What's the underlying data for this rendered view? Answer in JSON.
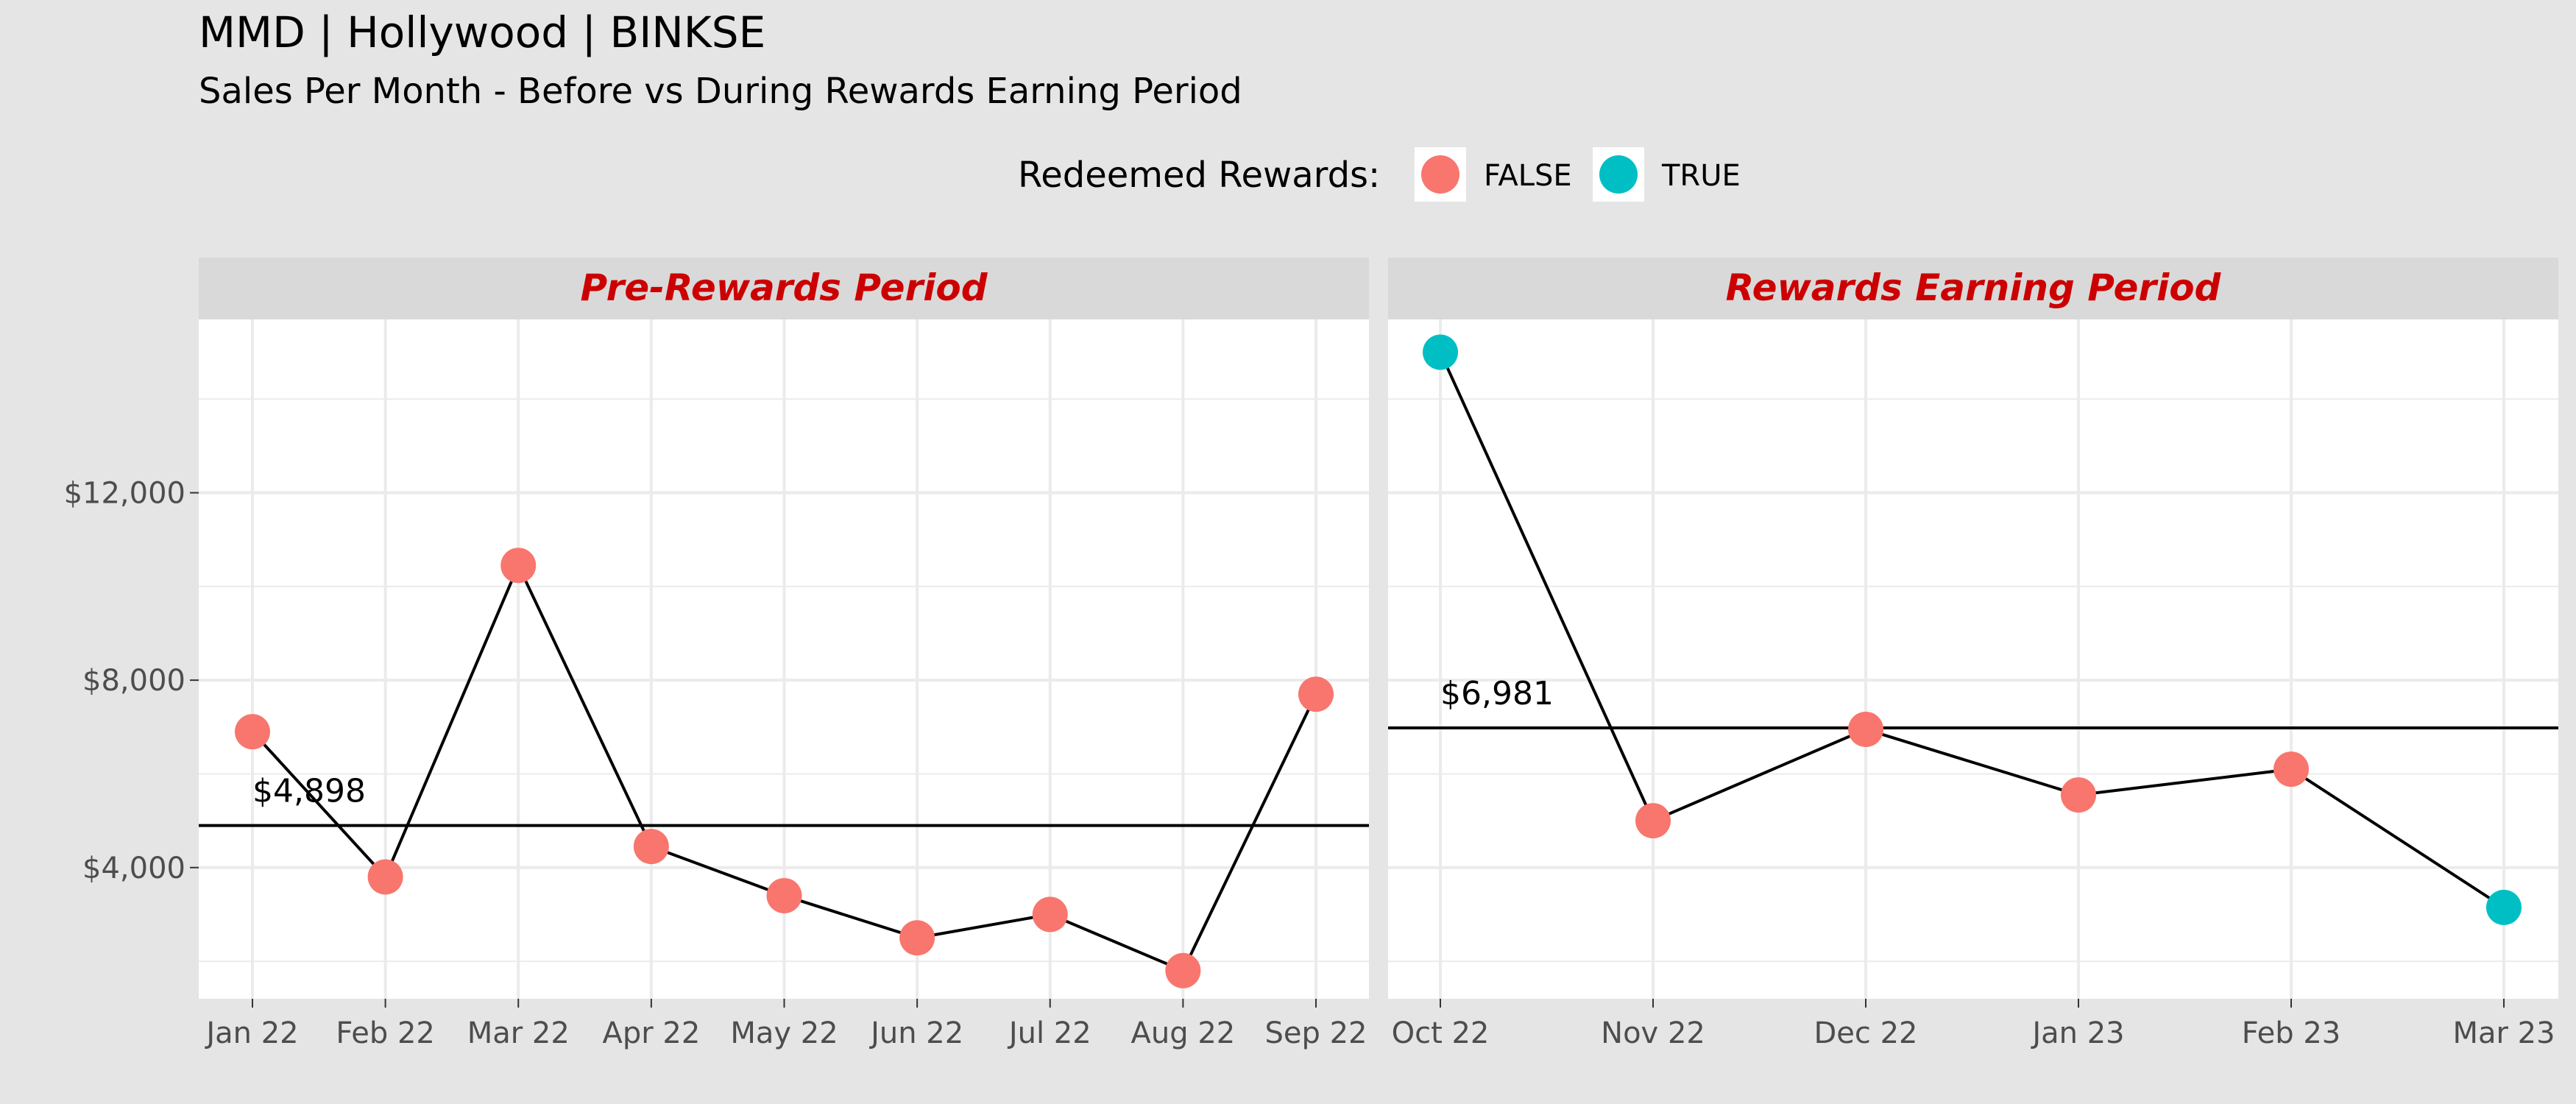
{
  "chart_data": {
    "type": "line",
    "title": "MMD | Hollywood | BINKSE",
    "subtitle": "Sales Per Month - Before vs During Rewards Earning Period",
    "ylabel": "",
    "xlabel": "",
    "ylim": [
      1200,
      15700
    ],
    "y_ticks": [
      {
        "value": 4000,
        "label": "$4,000"
      },
      {
        "value": 8000,
        "label": "$8,000"
      },
      {
        "value": 12000,
        "label": "$12,000"
      }
    ],
    "legend": {
      "title": "Redeemed Rewards:",
      "position": "top",
      "entries": [
        {
          "label": "FALSE",
          "color": "#f8766d"
        },
        {
          "label": "TRUE",
          "color": "#00bfc4"
        }
      ]
    },
    "colors": {
      "strip_text": "#cc0000",
      "panel_bg": "#ffffff",
      "grid": "#ebebeb",
      "strip_bg": "#d9d9d9",
      "line": "#000000"
    },
    "grid": true,
    "panels": [
      {
        "title": "Pre-Rewards Period",
        "x": [
          "2022-01",
          "2022-02",
          "2022-03",
          "2022-04",
          "2022-05",
          "2022-06",
          "2022-07",
          "2022-08",
          "2022-09"
        ],
        "x_labels": [
          "Jan 22",
          "Feb 22",
          "Mar 22",
          "Apr 22",
          "May 22",
          "Jun 22",
          "Jul 22",
          "Aug 22",
          "Sep 22"
        ],
        "values": [
          6900,
          3800,
          10450,
          4450,
          3400,
          2500,
          3000,
          1800,
          7700
        ],
        "redeemed": [
          false,
          false,
          false,
          false,
          false,
          false,
          false,
          false,
          false
        ],
        "mean": 4898,
        "mean_label": "$4,898"
      },
      {
        "title": "Rewards Earning Period",
        "x": [
          "2022-10",
          "2022-11",
          "2022-12",
          "2023-01",
          "2023-02",
          "2023-03"
        ],
        "x_labels": [
          "Oct 22",
          "Nov 22",
          "Dec 22",
          "Jan 23",
          "Feb 23",
          "Mar 23"
        ],
        "values": [
          15000,
          5000,
          6950,
          5550,
          6100,
          3150
        ],
        "redeemed": [
          true,
          false,
          false,
          false,
          false,
          true
        ],
        "mean": 6981,
        "mean_label": "$6,981"
      }
    ]
  }
}
